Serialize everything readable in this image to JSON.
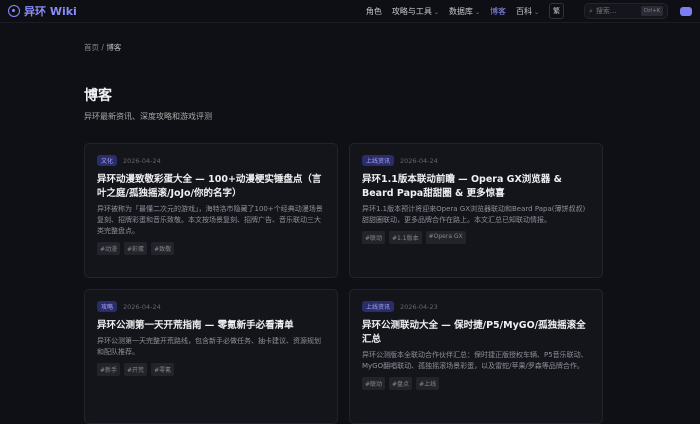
{
  "nav": {
    "brand": "异环 Wiki",
    "links": [
      {
        "label": "角色"
      },
      {
        "label": "攻略与工具",
        "dropdown": true
      },
      {
        "label": "数据库",
        "dropdown": true
      },
      {
        "label": "博客",
        "active": true
      },
      {
        "label": "百科",
        "dropdown": true
      }
    ],
    "lang": "繁",
    "search_placeholder": "搜索...",
    "search_shortcut": "Ctrl+K"
  },
  "breadcrumb": {
    "home": "首页",
    "sep": "/",
    "current": "博客"
  },
  "page": {
    "title": "博客",
    "subtitle": "异环最新资讯、深度攻略和游戏评测"
  },
  "posts": [
    {
      "category": "文化",
      "date": "2026-04-24",
      "title": "异环动漫致敬彩蛋大全 — 100+动漫梗实锤盘点（言叶之庭/孤独摇滚/JoJo/你的名字）",
      "desc": "异环被称为「最懂二次元的游戏」，海特洛市隐藏了100+个经典动漫场景复刻、招牌彩蛋和音乐致敬。本文按场景复刻、招牌广告、音乐联动三大类完整盘点。",
      "tags": [
        "#动漫",
        "#彩蛋",
        "#致敬"
      ]
    },
    {
      "category": "上线资讯",
      "date": "2026-04-24",
      "title": "异环1.1版本联动前瞻 — Opera GX浏览器 & Beard Papa甜甜圈 & 更多惊喜",
      "desc": "异环1.1版本预计将迎来Opera GX浏览器联动和Beard Papa(薄饼叔叔)甜甜圈联动，更多品牌合作在路上。本文汇总已知联动情报。",
      "tags": [
        "#联动",
        "#1.1版本",
        "#Opera GX"
      ]
    },
    {
      "category": "攻略",
      "date": "2026-04-24",
      "title": "异环公测第一天开荒指南 — 零氪新手必看清单",
      "desc": "异环公测第一天完整开荒路线，包含新手必做任务、抽卡建议、资源规划和配队推荐。",
      "tags": [
        "#新手",
        "#开荒",
        "#零氪"
      ]
    },
    {
      "category": "上线资讯",
      "date": "2026-04-23",
      "title": "异环公测联动大全 — 保时捷/P5/MyGO/孤独摇滚全汇总",
      "desc": "异环公测版本全联动合作伙伴汇总：保时捷正版授权车辆、P5音乐联动、MyGO翻唱联动、孤独摇滚场景彩蛋，以及雷蛇/苹果/罗森等品牌合作。",
      "tags": [
        "#联动",
        "#盘点",
        "#上线"
      ]
    }
  ]
}
